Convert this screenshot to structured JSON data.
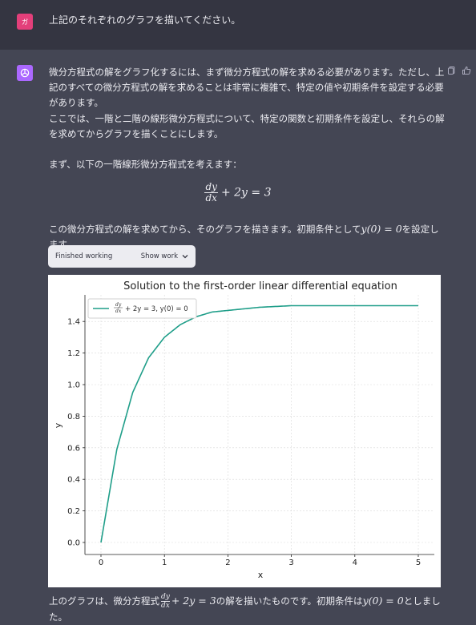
{
  "user": {
    "avatar_text": "ガ",
    "message": "上記のそれぞれのグラフを描いてください。"
  },
  "assistant": {
    "para1": "微分方程式の解をグラフ化するには、まず微分方程式の解を求める必要があります。ただし、上記のすべての微分方程式の解を求めることは非常に複雑で、特定の値や初期条件を設定する必要があります。",
    "para2": "ここでは、一階と二階の線形微分方程式について、特定の関数と初期条件を設定し、それらの解を求めてからグラフを描くことにします。",
    "para3": "まず、以下の一階線形微分方程式を考えます：",
    "eq_num": "dy",
    "eq_den": "dx",
    "eq_rest": "+ 2y = 3",
    "para4_a": "この微分方程式の解を求めてから、そのグラフを描きます。初期条件として",
    "para4_math": "y(0) = 0",
    "para4_b": "を設定します。",
    "work_status": "Finished working",
    "show_work": "Show work",
    "para5_a": "上のグラフは、微分方程式",
    "para5_num": "dy",
    "para5_den": "dx",
    "para5_eq": "+ 2y = 3",
    "para5_b": "の解を描いたものです。初期条件は",
    "para5_math": "y(0) = 0",
    "para5_c": "としました。"
  },
  "colors": {
    "line": "#1f9e89",
    "user_avatar": "#e33f7a",
    "bot_avatar": "#ab68ff"
  },
  "chart_data": {
    "type": "line",
    "title": "Solution to the first-order linear differential equation",
    "xlabel": "x",
    "ylabel": "y",
    "xlim": [
      0,
      5
    ],
    "ylim": [
      0,
      1.5
    ],
    "xticks": [
      "0",
      "1",
      "2",
      "3",
      "4",
      "5"
    ],
    "yticks": [
      "0.0",
      "0.2",
      "0.4",
      "0.6",
      "0.8",
      "1.0",
      "1.2",
      "1.4"
    ],
    "grid": true,
    "legend_position": "top-left",
    "series": [
      {
        "name": "dy/dx + 2y = 3, y(0) = 0",
        "legend_num": "dy",
        "legend_den": "dx",
        "legend_rest": "+ 2y = 3, y(0) = 0",
        "x": [
          0,
          0.25,
          0.5,
          0.75,
          1.0,
          1.25,
          1.5,
          1.75,
          2.0,
          2.5,
          3.0,
          3.5,
          4.0,
          4.5,
          5.0
        ],
        "y": [
          0,
          0.59,
          0.95,
          1.17,
          1.3,
          1.38,
          1.43,
          1.46,
          1.47,
          1.49,
          1.5,
          1.5,
          1.5,
          1.5,
          1.5
        ]
      }
    ]
  }
}
